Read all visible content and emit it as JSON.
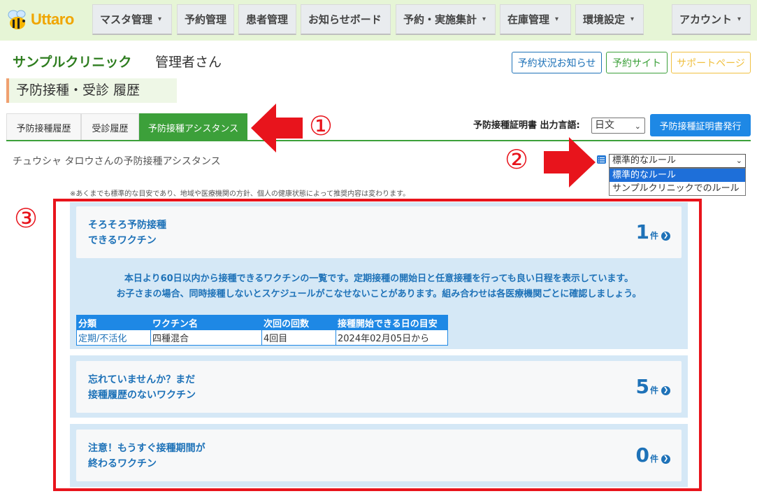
{
  "app": {
    "logo_text": "Uttaro"
  },
  "nav": {
    "items": [
      {
        "label": "マスタ管理",
        "caret": true
      },
      {
        "label": "予約管理",
        "caret": false
      },
      {
        "label": "患者管理",
        "caret": false
      },
      {
        "label": "お知らせボード",
        "caret": false
      },
      {
        "label": "予約・実施集計",
        "caret": true
      },
      {
        "label": "在庫管理",
        "caret": true
      },
      {
        "label": "環境設定",
        "caret": true
      },
      {
        "label": "アカウント",
        "caret": true
      }
    ],
    "caret_glyph": "▾"
  },
  "header": {
    "clinic_name": "サンプルクリニック",
    "user_name": "管理者さん",
    "buttons": [
      {
        "label": "予約状況お知らせ",
        "color": "#1e72b8"
      },
      {
        "label": "予約サイト",
        "color": "#3ca03a"
      },
      {
        "label": "サポートページ",
        "color": "#f0c040"
      }
    ]
  },
  "page_title": "予防接種・受診 履歴",
  "tabs": [
    {
      "label": "予防接種履歴",
      "active": false
    },
    {
      "label": "受診履歴",
      "active": false
    },
    {
      "label": "予防接種アシスタンス",
      "active": true
    }
  ],
  "certificate": {
    "label": "予防接種証明書 出力言語:",
    "language_value": "日文",
    "issue_button": "予防接種証明書発行"
  },
  "assistance": {
    "title": "チュウシャ タロウさんの予防接種アシスタンス",
    "rule_selected": "標準的なルール",
    "rule_options": [
      "標準的なルール",
      "サンプルクリニックでのルール"
    ],
    "note": "※あくまでも標準的な目安であり、地域や医療機関の方針、個人の健康状態によって推奨内容は変わります。"
  },
  "annotations": {
    "n1": "①",
    "n2": "②",
    "n3": "③"
  },
  "sections": [
    {
      "title_line1": "そろそろ予防接種",
      "title_line2": "できるワクチン",
      "count": "1",
      "unit": "件",
      "desc_line1": "本日より60日以内から接種できるワクチンの一覧です。定期接種の開始日と任意接種を行っても良い日程を表示しています。",
      "desc_line2": "お子さまの場合、同時接種しないとスケジュールがこなせないことがあります。組み合わせは各医療機関ごとに確認しましょう。",
      "table": {
        "headers": [
          "分類",
          "ワクチン名",
          "次回の回数",
          "接種開始できる日の目安"
        ],
        "rows": [
          [
            "定期/不活化",
            "四種混合",
            "4回目",
            "2024年02月05日から"
          ]
        ]
      }
    },
    {
      "title_line1": "忘れていませんか？まだ",
      "title_line2": "接種履歴のないワクチン",
      "count": "5",
      "unit": "件"
    },
    {
      "title_line1": "注意！もうすぐ接種期間が",
      "title_line2": "終わるワクチン",
      "count": "0",
      "unit": "件"
    }
  ],
  "colors": {
    "brand_green": "#3ca03a",
    "primary_blue": "#1e88e5",
    "annotation_red": "#e8141c"
  }
}
